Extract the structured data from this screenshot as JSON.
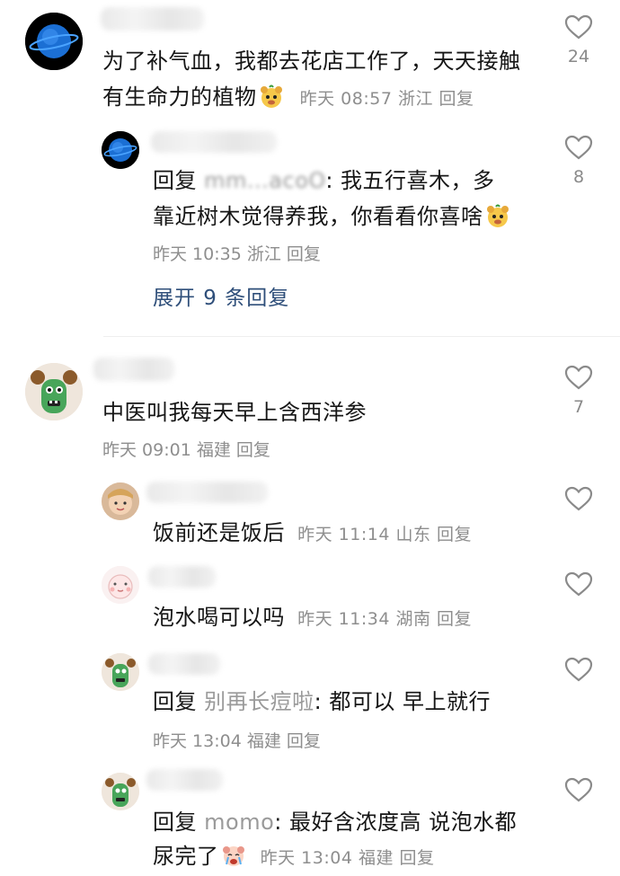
{
  "comments": [
    {
      "text_line1": "为了补气血，我都去花店工作了，天天接触",
      "text_line2": "有生命力的植物",
      "time": "昨天 08:57",
      "location": "浙江",
      "reply_label": "回复",
      "likes": "24",
      "emoji": "bear-face-emoji"
    },
    {
      "prefix": "回复",
      "mention": "mm...acoO",
      "text_line1": ": 我五行喜木，多",
      "text_line2": "靠近树木觉得养我，你看看你喜啥",
      "time": "昨天 10:35",
      "location": "浙江",
      "reply_label": "回复",
      "likes": "8",
      "emoji": "bear-face-emoji"
    },
    {
      "expand_label": "展开 9 条回复"
    },
    {
      "text": "中医叫我每天早上含西洋参",
      "time": "昨天 09:01",
      "location": "福建",
      "reply_label": "回复",
      "likes": "7"
    },
    {
      "text": "饭前还是饭后",
      "time": "昨天 11:14",
      "location": "山东",
      "reply_label": "回复",
      "likes": ""
    },
    {
      "text": "泡水喝可以吗",
      "time": "昨天 11:34",
      "location": "湖南",
      "reply_label": "回复",
      "likes": ""
    },
    {
      "prefix": "回复",
      "mention": "别再长痘啦",
      "text": ": 都可以 早上就行",
      "time": "昨天 13:04",
      "location": "福建",
      "reply_label": "回复",
      "likes": ""
    },
    {
      "prefix": "回复",
      "mention": "momo",
      "text_line1": ": 最好含浓度高  说泡水都",
      "text_line2": "尿完了",
      "time": "昨天 13:04",
      "location": "福建",
      "reply_label": "回复",
      "likes": "",
      "emoji": "crying-face-emoji"
    }
  ],
  "colors": {
    "meta": "#8e8e8e",
    "expand": "#2f4f7a",
    "heart": "#8a8a8a"
  }
}
